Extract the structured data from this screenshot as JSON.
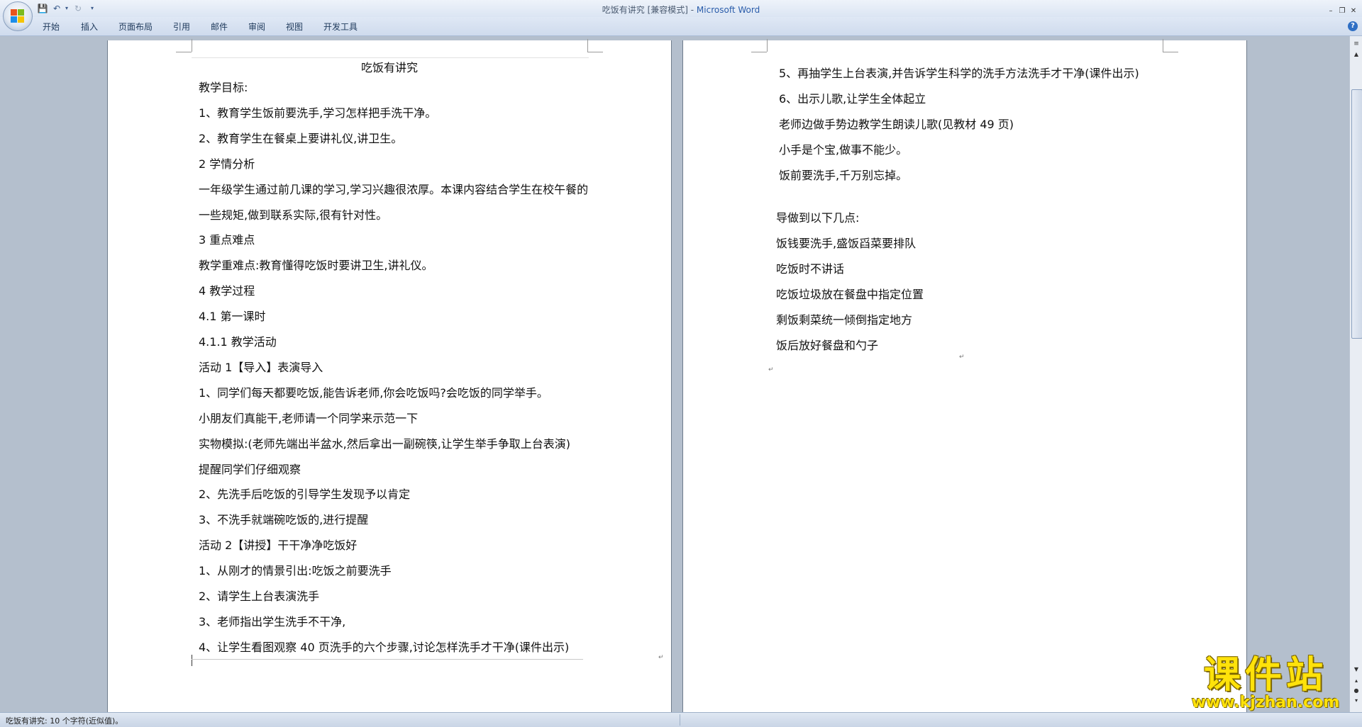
{
  "window": {
    "title_doc": "吃饭有讲究 [兼容模式] - ",
    "title_app": "Microsoft Word"
  },
  "ribbon": {
    "tabs": [
      "开始",
      "插入",
      "页面布局",
      "引用",
      "邮件",
      "审阅",
      "视图",
      "开发工具"
    ]
  },
  "page1": {
    "title": "吃饭有讲究",
    "lines": [
      "教学目标:",
      "1、教育学生饭前要洗手,学习怎样把手洗干净。",
      "2、教育学生在餐桌上要讲礼仪,讲卫生。",
      "2 学情分析",
      "一年级学生通过前几课的学习,学习兴趣很浓厚。本课内容结合学生在校午餐的",
      "一些规矩,做到联系实际,很有针对性。",
      "3 重点难点",
      "教学重难点:教育懂得吃饭时要讲卫生,讲礼仪。",
      "4 教学过程",
      "4.1 第一课时",
      "4.1.1 教学活动",
      "活动 1【导入】表演导入",
      "1、同学们每天都要吃饭,能告诉老师,你会吃饭吗?会吃饭的同学举手。",
      "小朋友们真能干,老师请一个同学来示范一下",
      "实物模拟:(老师先端出半盆水,然后拿出一副碗筷,让学生举手争取上台表演)",
      "提醒同学们仔细观察",
      "2、先洗手后吃饭的引导学生发现予以肯定",
      "3、不洗手就端碗吃饭的,进行提醒",
      "活动 2【讲授】干干净净吃饭好",
      "1、从刚才的情景引出:吃饭之前要洗手",
      "2、请学生上台表演洗手",
      "3、老师指出学生洗手不干净,",
      "4、让学生看图观察 40 页洗手的六个步骤,讨论怎样洗手才干净(课件出示)"
    ]
  },
  "page2": {
    "lines_a": [
      "5、再抽学生上台表演,并告诉学生科学的洗手方法洗手才干净(课件出示)",
      "6、出示儿歌,让学生全体起立",
      "老师边做手势边教学生朗读儿歌(见教材 49 页)",
      "小手是个宝,做事不能少。",
      "饭前要洗手,千万别忘掉。"
    ],
    "lines_b": [
      "导做到以下几点:",
      "饭钱要洗手,盛饭舀菜要排队",
      "吃饭时不讲话",
      "吃饭垃圾放在餐盘中指定位置",
      "剩饭剩菜统一倾倒指定地方",
      "饭后放好餐盘和勺子"
    ]
  },
  "status": {
    "text": "吃饭有讲究: 10 个字符(近似值)。"
  },
  "watermark": {
    "text": "课件站",
    "url": "www.kjzhan.com"
  }
}
